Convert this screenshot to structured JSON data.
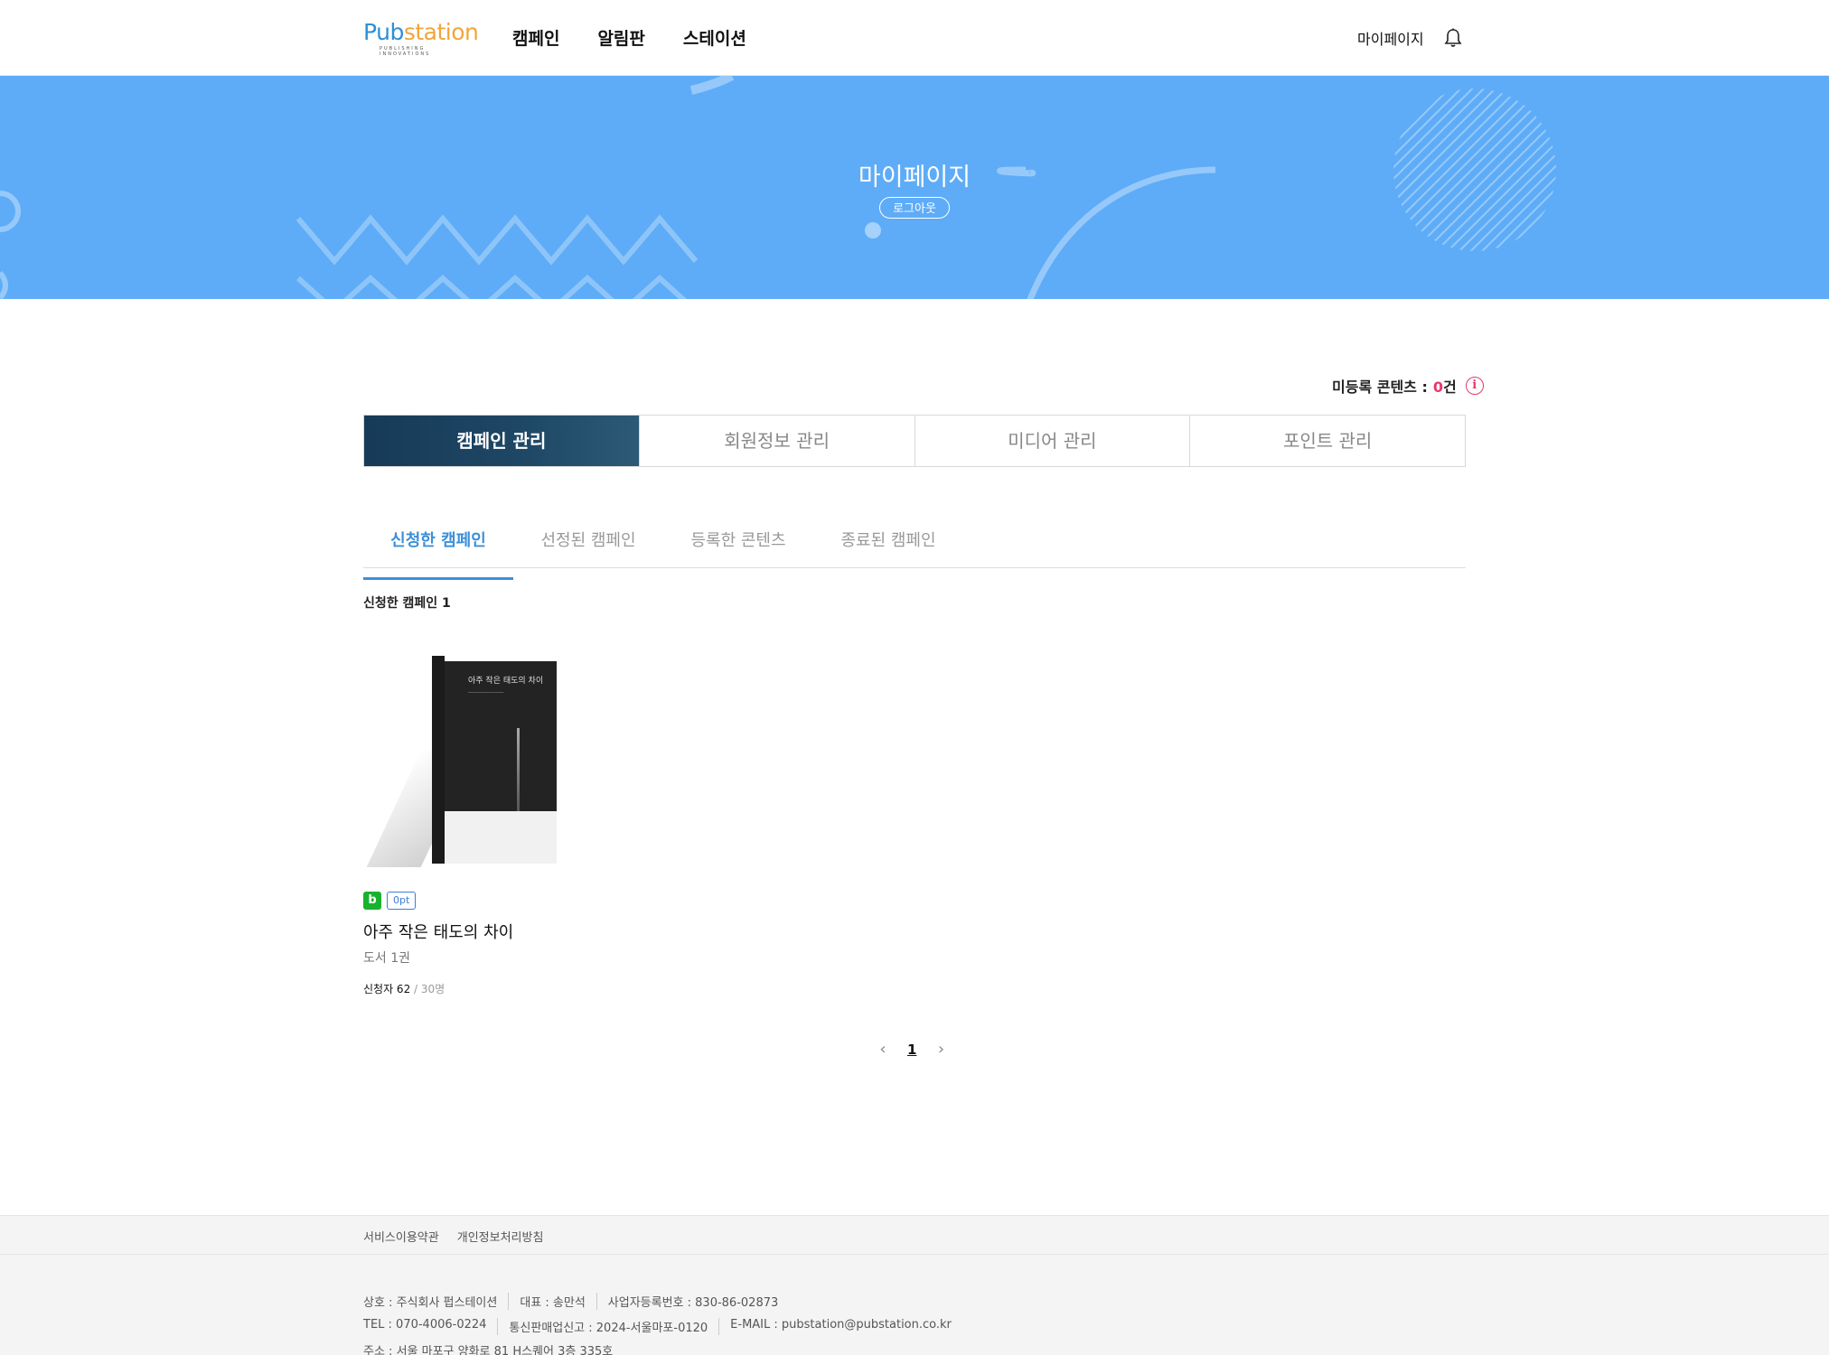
{
  "header": {
    "logo_main_a": "Pub",
    "logo_main_b": "station",
    "logo_tagline": "PUBLISHING INNOVATIONS",
    "nav": [
      "캠페인",
      "알림판",
      "스테이션"
    ],
    "mypage_label": "마이페이지"
  },
  "hero": {
    "title": "마이페이지",
    "logout_label": "로그아웃"
  },
  "unregistered": {
    "label": "미등록 콘텐츠 :",
    "count": "0",
    "unit": "건",
    "info_glyph": "i"
  },
  "main_tabs": [
    "캠페인 관리",
    "회원정보 관리",
    "미디어 관리",
    "포인트 관리"
  ],
  "sub_tabs": [
    "신청한 캠페인",
    "선정된 캠페인",
    "등록한 콘텐츠",
    "종료된 캠페인"
  ],
  "list": {
    "count_label": "신청한 캠페인 1"
  },
  "card": {
    "badge_platform": "b",
    "badge_points": "0pt",
    "title": "아주 작은 태도의 차이",
    "subtitle": "도서 1권",
    "applicants_label": "신청자 62",
    "capacity_label": " / 30명",
    "cover_title": "아주 작은 태도의 차이"
  },
  "pagination": {
    "prev": "‹",
    "current": "1",
    "next": "›"
  },
  "footer": {
    "links": [
      "서비스이용약관",
      "개인정보처리방침"
    ],
    "rows": [
      [
        "상호 : 주식회사 펍스테이션",
        "대표 : 송만석",
        "사업자등록번호 : 830-86-02873"
      ],
      [
        "TEL : 070-4006-0224",
        "통신판매업신고 : 2024-서울마포-0120",
        "E-MAIL : pubstation@pubstation.co.kr"
      ],
      [
        "주소 : 서울 마포구 양화로 81 H스퀘어 3층 335호"
      ]
    ]
  },
  "colors": {
    "hero_bg": "#5eacf7",
    "accent_blue": "#3b8fd9",
    "active_tab": "#163a57",
    "count_pink": "#e8376b",
    "badge_green": "#19b22e"
  }
}
